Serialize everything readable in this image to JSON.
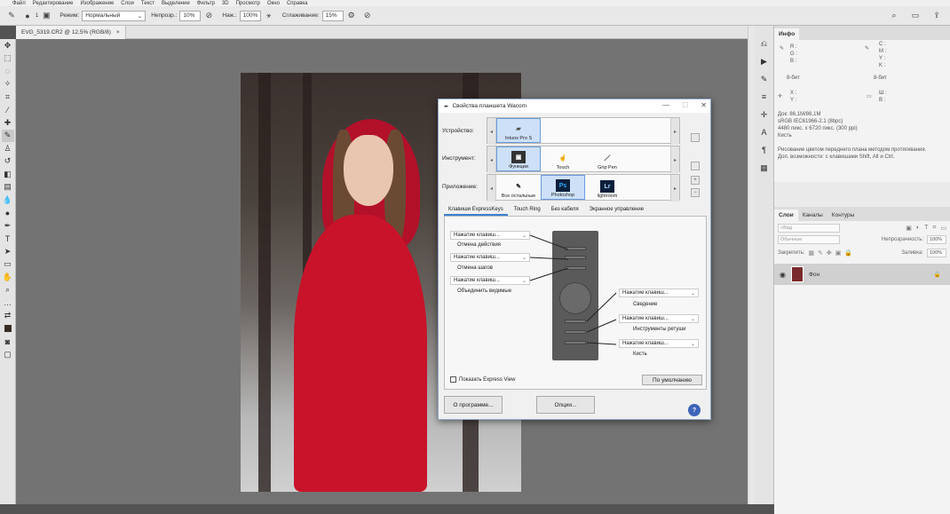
{
  "menubar": {
    "items": [
      "Файл",
      "Редактирование",
      "Изображение",
      "Слои",
      "Текст",
      "Выделение",
      "Фильтр",
      "3D",
      "Просмотр",
      "Окно",
      "Справка"
    ]
  },
  "options": {
    "mode_label": "Режим:",
    "mode_value": "Нормальный",
    "opacity_label": "Непрозр.:",
    "opacity_value": "10%",
    "pressure_label": "Наж.:",
    "pressure_value": "100%",
    "smoothing_label": "Сглаживание:",
    "smoothing_value": "15%",
    "brush_size": "1"
  },
  "document": {
    "tab_label": "EVG_5319.CR2 @ 12,5% (RGB/8)",
    "close": "×"
  },
  "info_panel": {
    "tab": "Инфо",
    "r": "R :",
    "g": "G :",
    "b": "B :",
    "c": "C :",
    "m": "M :",
    "y": "Y :",
    "k": "K :",
    "bit_left": "8-бит",
    "bit_right": "8-бит",
    "x": "X :",
    "y2": "Y :",
    "w": "Ш :",
    "h": "В :",
    "doc_size": "Док: 86,1M/86,1M",
    "profile": "sRGB IEC61966-2.1 (8bpc)",
    "dimensions": "4480 пикс. x 6720 пикс. (300 ppi)",
    "tool": "Кисть",
    "hint1": "Рисование цветом переднего плана методом протягивания.",
    "hint2": "Доп. возможности: с клавишами Shift, Alt и Ctrl."
  },
  "layers_panel": {
    "tabs": [
      "Слои",
      "Каналы",
      "Контуры"
    ],
    "kind": "Вид",
    "blend": "Обычные",
    "opacity_label": "Непрозрачность:",
    "opacity": "100%",
    "lock_label": "Закрепить:",
    "fill_label": "Заливка:",
    "fill": "100%",
    "layer_name": "Фон"
  },
  "wacom": {
    "title": "Свойства планшета Wacom",
    "device_label": "Устройство:",
    "device": "Intuos Pro S",
    "tool_label": "Инструмент:",
    "tools": [
      "Функции",
      "Touch",
      "Grip Pen"
    ],
    "app_label": "Приложение:",
    "apps": [
      "Все остальные",
      "Photoshop",
      "lightroom"
    ],
    "app_icons": [
      "Ps",
      "Lr"
    ],
    "tabs": [
      "Клавиши ExpressKeys",
      "Touch Ring",
      "Без кабеля",
      "Экранное управление"
    ],
    "left_keys": [
      {
        "dd": "Нажатие клавиш...",
        "action": "Отмена действия"
      },
      {
        "dd": "Нажатие клавиш...",
        "action": "Отмена шагов"
      },
      {
        "dd": "Нажатие клавиш...",
        "action": "Объединить видимые"
      }
    ],
    "right_keys": [
      {
        "dd": "Нажатие клавиш...",
        "action": "Сведение"
      },
      {
        "dd": "Нажатие клавиш...",
        "action": "Инструменты ретуши"
      },
      {
        "dd": "Нажатие клавиш...",
        "action": "Кисть"
      }
    ],
    "show_express_view": "Показать Express View",
    "default_btn": "По умолчанию",
    "about_btn": "О программе...",
    "options_btn": "Опции...",
    "help": "?"
  }
}
